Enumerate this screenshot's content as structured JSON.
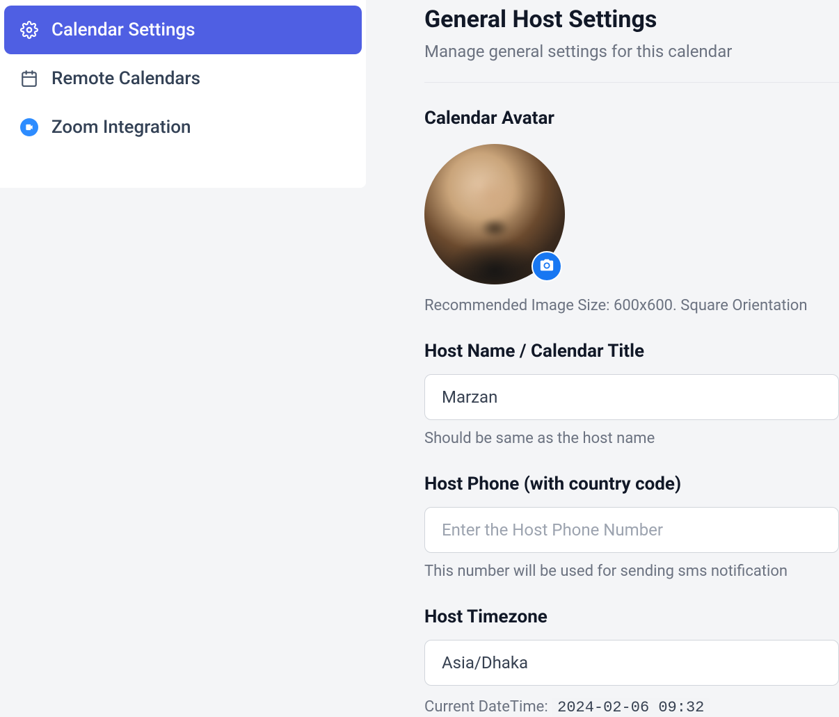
{
  "sidebar": {
    "items": [
      {
        "label": "Calendar Settings",
        "icon": "gear-icon",
        "active": true
      },
      {
        "label": "Remote Calendars",
        "icon": "calendar-icon",
        "active": false
      },
      {
        "label": "Zoom Integration",
        "icon": "zoom-icon",
        "active": false
      }
    ]
  },
  "page": {
    "title": "General Host Settings",
    "subtitle": "Manage general settings for this calendar"
  },
  "avatar": {
    "section_label": "Calendar Avatar",
    "help_text": "Recommended Image Size: 600x600. Square Orientation"
  },
  "host_name": {
    "label": "Host Name / Calendar Title",
    "value": "Marzan",
    "help": "Should be same as the host name"
  },
  "host_phone": {
    "label": "Host Phone (with country code)",
    "value": "",
    "placeholder": "Enter the Host Phone Number",
    "help": "This number will be used for sending sms notification"
  },
  "host_timezone": {
    "label": "Host Timezone",
    "value": "Asia/Dhaka",
    "datetime_label": "Current DateTime: ",
    "datetime_value": "2024-02-06 09:32"
  }
}
